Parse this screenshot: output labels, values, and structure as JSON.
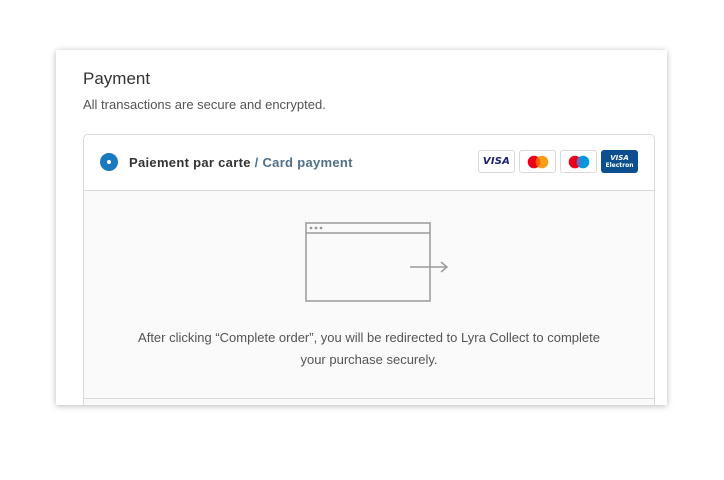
{
  "payment": {
    "title": "Payment",
    "subtitle": "All transactions are secure and encrypted."
  },
  "option": {
    "label_fr": "Paiement par carte",
    "separator": " / ",
    "label_en": "Card payment",
    "selected": true
  },
  "card_logos": [
    {
      "name": "visa",
      "text": "VISA"
    },
    {
      "name": "mastercard",
      "icon": "mastercard-icon"
    },
    {
      "name": "maestro",
      "icon": "maestro-icon"
    },
    {
      "name": "visa-electron",
      "text_top": "VISA",
      "text_bottom": "Electron"
    }
  ],
  "redirect": {
    "icon": "browser-redirect-icon",
    "message": "After clicking “Complete order”, you will be redirected to Lyra Collect to complete your purchase securely."
  },
  "colors": {
    "accent": "#197bbd",
    "label_en": "#4e6f8a",
    "mastercard_red": "#eb001b",
    "mastercard_yellow": "#f79e1b",
    "maestro_blue": "#0099df",
    "electron_bg": "#0b4f8f"
  }
}
